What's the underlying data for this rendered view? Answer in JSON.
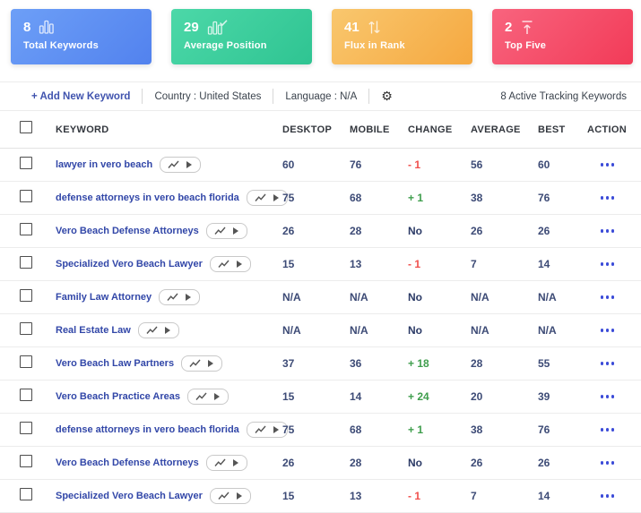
{
  "cards": [
    {
      "value": "8",
      "label": "Total Keywords",
      "icon": "bar-chart-icon",
      "gradient_from": "#6d9ff7",
      "gradient_to": "#5282ee"
    },
    {
      "value": "29",
      "label": "Average Position",
      "icon": "bar-chart-check-icon",
      "gradient_from": "#4cd8a8",
      "gradient_to": "#2fc492"
    },
    {
      "value": "41",
      "label": "Flux in Rank",
      "icon": "up-down-arrows-icon",
      "gradient_from": "#f9c76e",
      "gradient_to": "#f5a840"
    },
    {
      "value": "2",
      "label": "Top Five",
      "icon": "arrow-to-top-icon",
      "gradient_from": "#f8647e",
      "gradient_to": "#f23b58"
    }
  ],
  "toolbar": {
    "add_keyword_label": "+ Add New Keyword",
    "country_label": "Country : United States",
    "language_label": "Language : N/A",
    "settings_icon_glyph": "⚙",
    "active_keywords_label": "8 Active Tracking Keywords"
  },
  "table": {
    "headers": {
      "keyword": "KEYWORD",
      "desktop": "DESKTOP",
      "mobile": "MOBILE",
      "change": "CHANGE",
      "average": "AVERAGE",
      "best": "BEST",
      "action": "ACTION"
    },
    "rows": [
      {
        "keyword": "lawyer in vero beach",
        "desktop": "60",
        "mobile": "76",
        "change": "- 1",
        "change_type": "down",
        "average": "56",
        "best": "60"
      },
      {
        "keyword": "defense attorneys in vero beach florida",
        "desktop": "75",
        "mobile": "68",
        "change": "+ 1",
        "change_type": "up",
        "average": "38",
        "best": "76"
      },
      {
        "keyword": "Vero Beach Defense Attorneys",
        "desktop": "26",
        "mobile": "28",
        "change": "No",
        "change_type": "none",
        "average": "26",
        "best": "26"
      },
      {
        "keyword": "Specialized Vero Beach Lawyer",
        "desktop": "15",
        "mobile": "13",
        "change": "- 1",
        "change_type": "down",
        "average": "7",
        "best": "14"
      },
      {
        "keyword": "Family Law Attorney",
        "desktop": "N/A",
        "mobile": "N/A",
        "change": "No",
        "change_type": "none",
        "average": "N/A",
        "best": "N/A"
      },
      {
        "keyword": "Real Estate Law",
        "desktop": "N/A",
        "mobile": "N/A",
        "change": "No",
        "change_type": "none",
        "average": "N/A",
        "best": "N/A"
      },
      {
        "keyword": "Vero Beach Law Partners",
        "desktop": "37",
        "mobile": "36",
        "change": "+ 18",
        "change_type": "up",
        "average": "28",
        "best": "55"
      },
      {
        "keyword": "Vero Beach Practice Areas",
        "desktop": "15",
        "mobile": "14",
        "change": "+ 24",
        "change_type": "up",
        "average": "20",
        "best": "39"
      },
      {
        "keyword": "defense attorneys in vero beach florida",
        "desktop": "75",
        "mobile": "68",
        "change": "+ 1",
        "change_type": "up",
        "average": "38",
        "best": "76"
      },
      {
        "keyword": "Vero Beach Defense Attorneys",
        "desktop": "26",
        "mobile": "28",
        "change": "No",
        "change_type": "none",
        "average": "26",
        "best": "26"
      },
      {
        "keyword": "Specialized Vero Beach Lawyer",
        "desktop": "15",
        "mobile": "13",
        "change": "- 1",
        "change_type": "down",
        "average": "7",
        "best": "14"
      }
    ]
  },
  "colors": {
    "change_up": "#3f9e4d",
    "change_down": "#f0504d",
    "change_none": "#2b3a66",
    "keyword_link": "#3247a8",
    "value_text": "#3d4b76",
    "action_dots": "#3b4bd8",
    "add_link": "#4053ae"
  }
}
